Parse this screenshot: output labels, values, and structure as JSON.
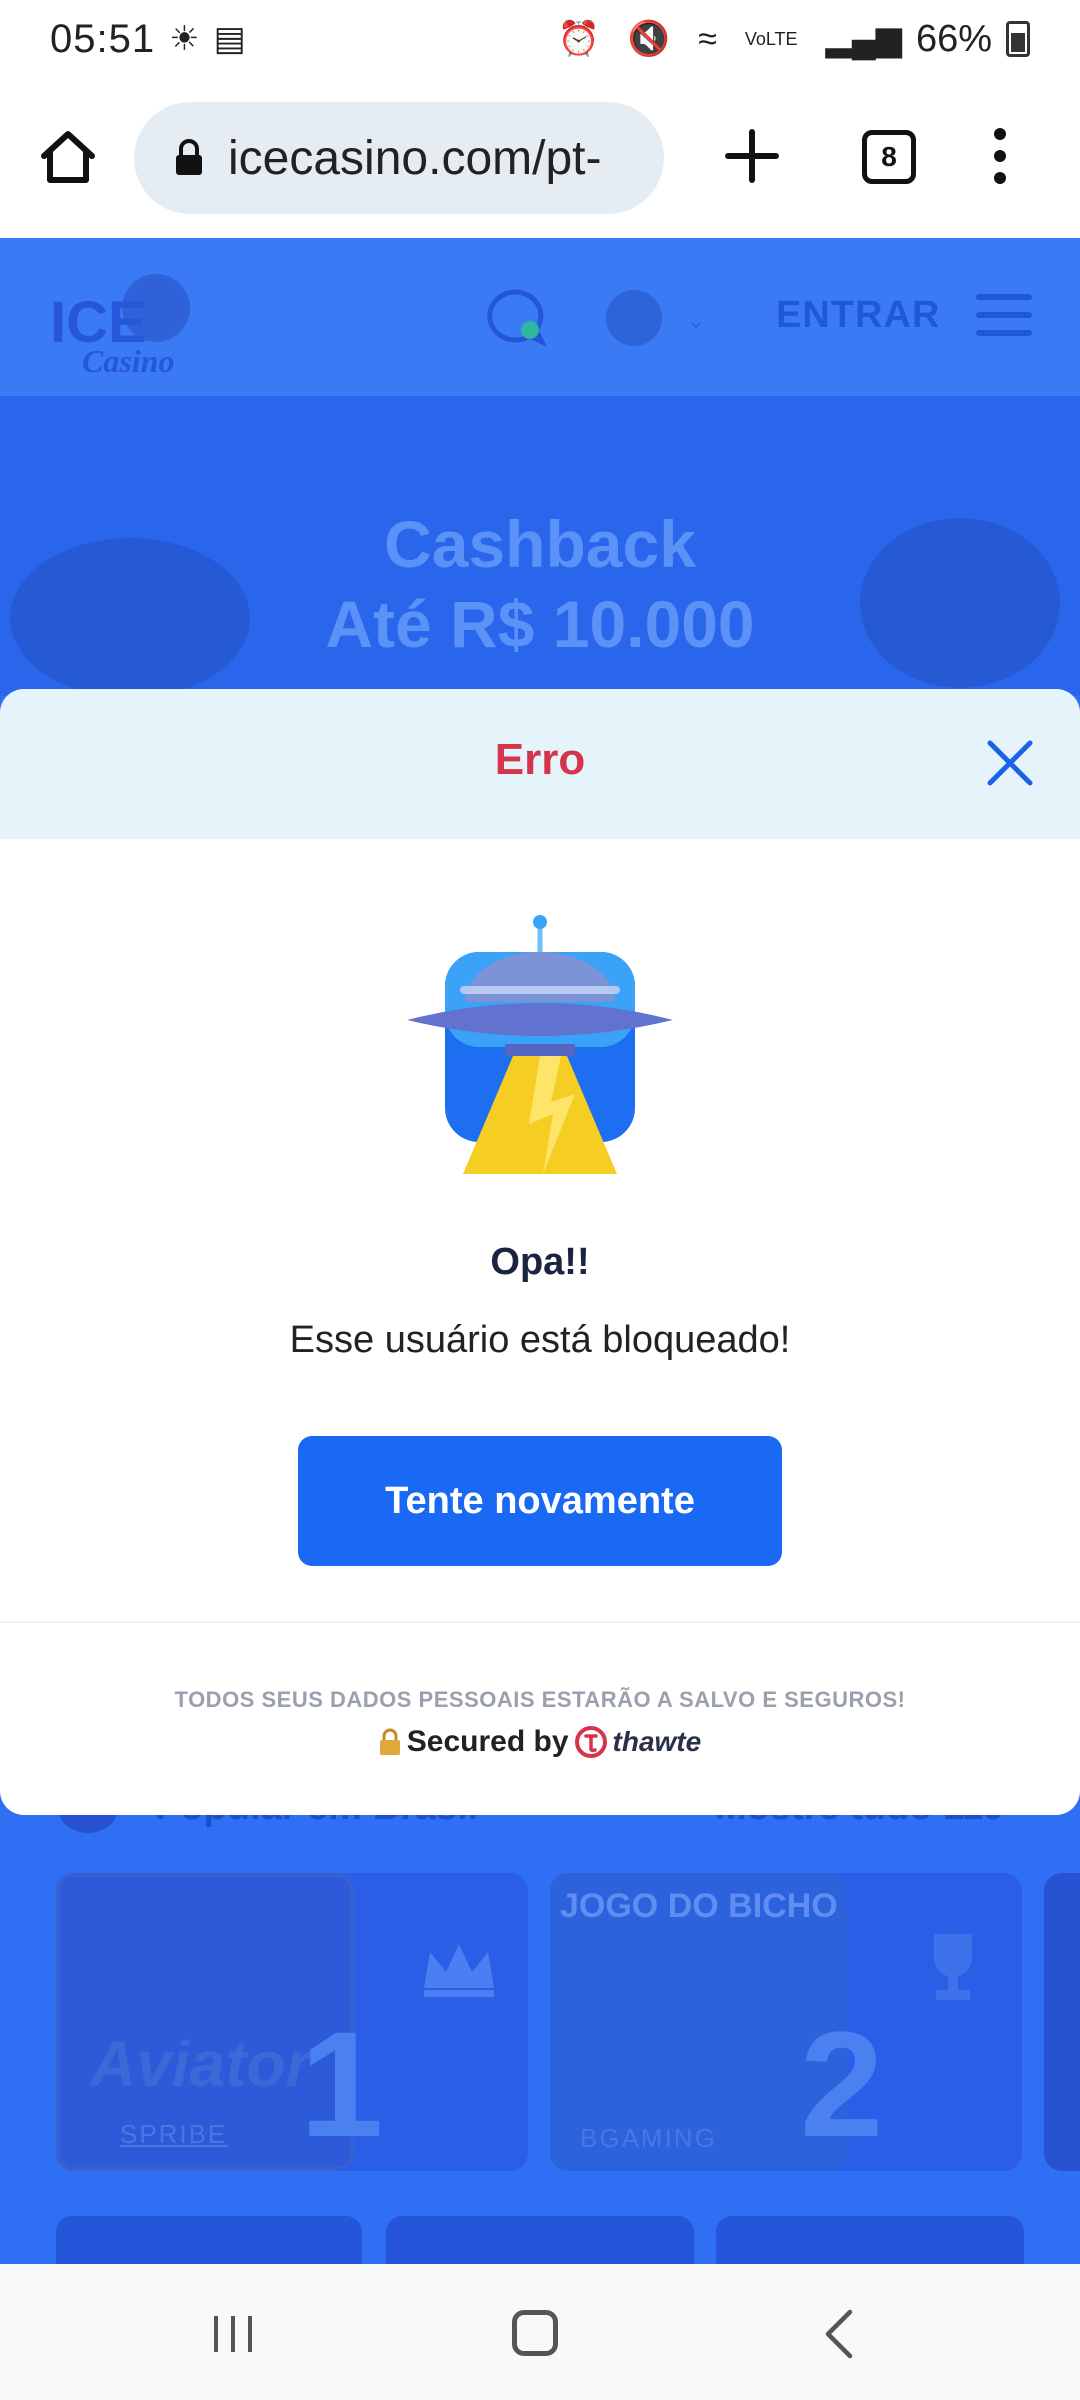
{
  "status_bar": {
    "time": "05:51",
    "battery": "66%",
    "icons": [
      "brightness-icon",
      "voicemail-icon",
      "alarm-icon",
      "mute-icon",
      "wifi-icon",
      "volte-icon",
      "signal-icon",
      "battery-icon"
    ]
  },
  "browser": {
    "url": "icecasino.com/pt-",
    "tab_count": "8"
  },
  "site": {
    "header": {
      "logo_text_1": "ICE",
      "logo_text_2": "Casino",
      "login_label": "ENTRAR"
    },
    "banner": {
      "line1": "Cashback",
      "line2": "Até R$ 10.000"
    },
    "section": {
      "title": "Popular em Brasil",
      "show_all": "Mostre tudo 119"
    },
    "games": [
      {
        "title": "Aviator",
        "provider": "SPRIBE",
        "rank": "1"
      },
      {
        "title": "JOGO DO BICHO",
        "provider": "BGAMING",
        "rank": "2"
      }
    ]
  },
  "modal": {
    "title": "Erro",
    "heading": "Opa!!",
    "message": "Esse usuário está bloqueado!",
    "retry_label": "Tente novamente",
    "security_note": "TODOS SEUS DADOS PESSOAIS ESTARÃO A SALVO E SEGUROS!",
    "secured_by": "Secured by",
    "secured_brand": "thawte"
  },
  "colors": {
    "accent": "#1a69f5",
    "error": "#d6344b",
    "modal_header_bg": "#e5f3fb",
    "site_overlay": "#2f6ff3"
  }
}
